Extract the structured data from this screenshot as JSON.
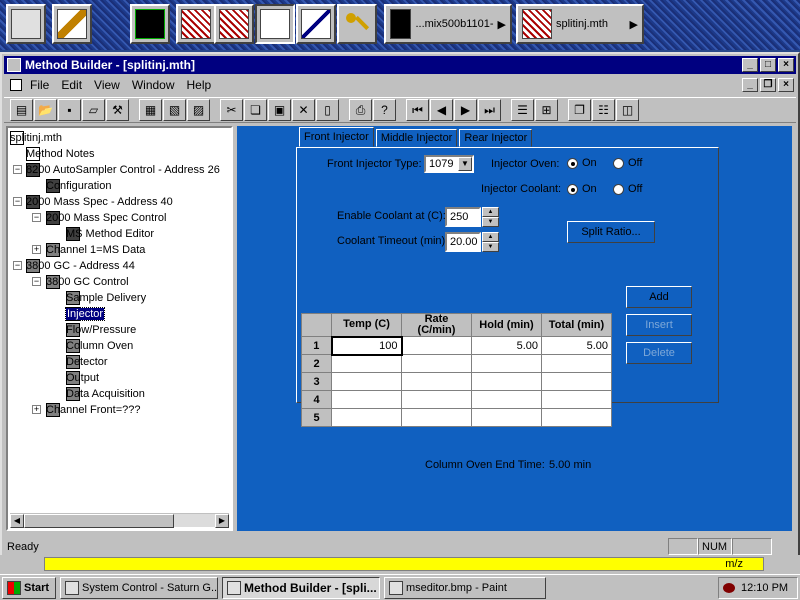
{
  "launcher": {
    "buttons": [
      "monitor-icon",
      "tools-icon",
      "spectrum-icon",
      "shuffle-icon",
      "chip-icon",
      "ms-sms-icon",
      "syringe-icon",
      "key-icon"
    ],
    "spectrum_task_label": "...mix500b1101-",
    "method_task_label": "splitinj.mth"
  },
  "window": {
    "title": "Method Builder - [splitinj.mth]",
    "menu": [
      "File",
      "Edit",
      "View",
      "Window",
      "Help"
    ]
  },
  "tree": {
    "items": [
      {
        "label": "splitinj.mth"
      },
      {
        "label": "Method Notes"
      },
      {
        "label": "8200 AutoSampler Control - Address 26"
      },
      {
        "label": "Configuration"
      },
      {
        "label": "2000 Mass Spec - Address 40"
      },
      {
        "label": "2000 Mass Spec Control"
      },
      {
        "label": "MS Method Editor"
      },
      {
        "label": "Channel 1=MS Data"
      },
      {
        "label": "3800 GC - Address 44"
      },
      {
        "label": "3800 GC Control"
      },
      {
        "label": "Sample Delivery"
      },
      {
        "label": "Injector"
      },
      {
        "label": "Flow/Pressure"
      },
      {
        "label": "Column Oven"
      },
      {
        "label": "Detector"
      },
      {
        "label": "Output"
      },
      {
        "label": "Data Acquisition"
      },
      {
        "label": "Channel Front=???"
      }
    ]
  },
  "tabs": [
    "Front Injector",
    "Middle Injector",
    "Rear Injector"
  ],
  "form": {
    "front_injector_type_label": "Front Injector Type:",
    "front_injector_type_value": "1079",
    "injector_oven_label": "Injector Oven:",
    "injector_coolant_label": "Injector Coolant:",
    "on_label": "On",
    "off_label": "Off",
    "enable_coolant_label": "Enable Coolant at (C):",
    "enable_coolant_value": "250",
    "coolant_timeout_label": "Coolant Timeout (min):",
    "coolant_timeout_value": "20.00",
    "split_ratio_button": "Split Ratio..."
  },
  "table": {
    "headers": [
      "Temp (C)",
      "Rate\n(C/min)",
      "Hold (min)",
      "Total (min)"
    ],
    "rows": [
      {
        "n": "1",
        "temp": "100",
        "rate": "",
        "hold": "5.00",
        "total": "5.00"
      },
      {
        "n": "2",
        "temp": "",
        "rate": "",
        "hold": "",
        "total": ""
      },
      {
        "n": "3",
        "temp": "",
        "rate": "",
        "hold": "",
        "total": ""
      },
      {
        "n": "4",
        "temp": "",
        "rate": "",
        "hold": "",
        "total": ""
      },
      {
        "n": "5",
        "temp": "",
        "rate": "",
        "hold": "",
        "total": ""
      }
    ]
  },
  "buttons": {
    "add": "Add",
    "insert": "Insert",
    "delete": "Delete"
  },
  "column_oven_end_time_label": "Column Oven End Time:",
  "column_oven_end_time_value": "5.00 min",
  "status": {
    "text": "Ready",
    "num": "NUM"
  },
  "strip": {
    "mz": "m/z"
  },
  "taskbar": {
    "start": "Start",
    "tasks": [
      "System Control - Saturn G...",
      "Method Builder - [spli...",
      "mseditor.bmp - Paint"
    ],
    "clock": "12:10 PM"
  },
  "colors": {
    "title_bg": "#000080",
    "panel_bg": "#1060c0",
    "highlight": "#ffff00"
  }
}
